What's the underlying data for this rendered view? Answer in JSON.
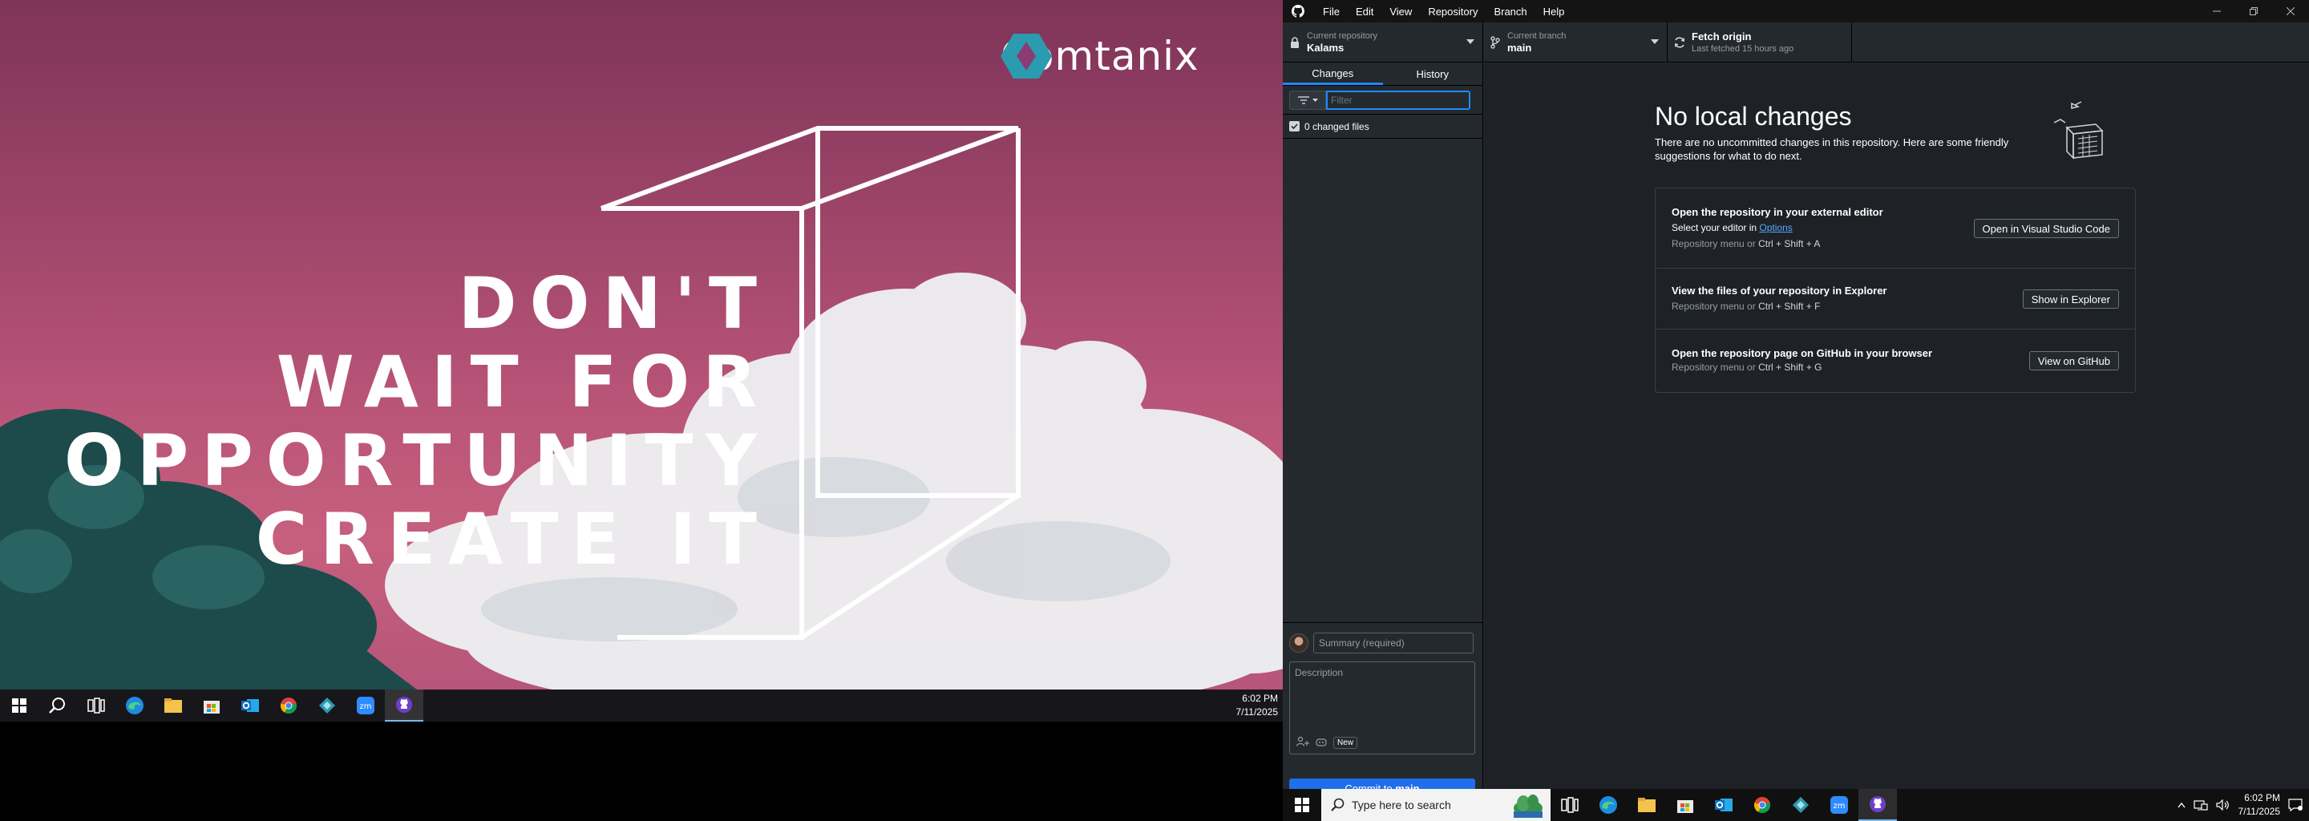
{
  "wallpaper": {
    "brand": "Comtanix",
    "quote_lines": [
      "DON'T",
      "WAIT FOR",
      "OPPORTUNITY",
      "CREATE IT"
    ]
  },
  "left_taskbar": {
    "time": "6:02 PM",
    "date": "7/11/2025",
    "apps": [
      "start-icon",
      "search-icon",
      "task-view-icon",
      "edge-icon",
      "file-explorer-icon",
      "store-icon",
      "outlook-icon",
      "chrome-icon",
      "vscode-icon",
      "zoom-icon",
      "github-desktop-icon"
    ]
  },
  "menu": [
    "File",
    "Edit",
    "View",
    "Repository",
    "Branch",
    "Help"
  ],
  "toolbar": {
    "repo_label": "Current repository",
    "repo_value": "Kalams",
    "branch_label": "Current branch",
    "branch_value": "main",
    "fetch_label": "Fetch origin",
    "fetch_sub": "Last fetched 15 hours ago"
  },
  "sidebar": {
    "tab_changes": "Changes",
    "tab_history": "History",
    "filter_placeholder": "Filter",
    "changed_files": "0 changed files",
    "summary_placeholder": "Summary (required)",
    "description_placeholder": "Description",
    "new_badge": "New",
    "commit_prefix": "Commit to",
    "commit_branch": "main"
  },
  "main": {
    "title": "No local changes",
    "description": "There are no uncommitted changes in this repository. Here are some friendly suggestions for what to do next.",
    "cards": [
      {
        "title": "Open the repository in your external editor",
        "sub_prefix": "Select your editor in",
        "sub_link": "Options",
        "keys_prefix": "Repository menu or",
        "keys": "Ctrl + Shift + A",
        "button": "Open in Visual Studio Code"
      },
      {
        "title": "View the files of your repository in Explorer",
        "keys_prefix": "Repository menu or",
        "keys": "Ctrl + Shift + F",
        "button": "Show in Explorer"
      },
      {
        "title": "Open the repository page on GitHub in your browser",
        "keys_prefix": "Repository menu or",
        "keys": "Ctrl + Shift + G",
        "button": "View on GitHub"
      }
    ]
  },
  "right_taskbar": {
    "search_placeholder": "Type here to search",
    "time": "6:02 PM",
    "date": "7/11/2025"
  },
  "colors": {
    "accent": "#2188ff",
    "commit_button": "#1f6feb",
    "app_bg": "#24292e",
    "main_bg": "#1e2227",
    "wallpaper_pink": "#b85477"
  }
}
